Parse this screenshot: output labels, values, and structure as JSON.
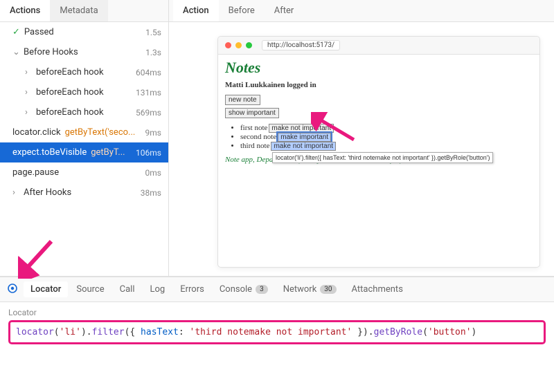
{
  "sidebar": {
    "tabs": {
      "actions": "Actions",
      "metadata": "Metadata"
    },
    "rows": {
      "passed": {
        "label": "Passed",
        "dur": "1.5s"
      },
      "before_hooks": {
        "label": "Before Hooks",
        "dur": "1.3s"
      },
      "be1": {
        "label": "beforeEach hook",
        "dur": "604ms"
      },
      "be2": {
        "label": "beforeEach hook",
        "dur": "131ms"
      },
      "be3": {
        "label": "beforeEach hook",
        "dur": "569ms"
      },
      "locator_click": {
        "prefix": "locator.click",
        "arg": "getByText('seco...",
        "dur": "9ms"
      },
      "expect": {
        "prefix": "expect.toBeVisible",
        "arg": "getByT...",
        "dur": "106ms"
      },
      "pause": {
        "label": "page.pause",
        "dur": "0ms"
      },
      "after_hooks": {
        "label": "After Hooks",
        "dur": "38ms"
      }
    }
  },
  "main_tabs": {
    "action": "Action",
    "before": "Before",
    "after": "After"
  },
  "browser": {
    "url": "http://localhost:5173/",
    "title": "Notes",
    "login_status": "Matti Luukkainen logged in",
    "new_note_btn": "new note",
    "show_important_btn": "show important",
    "notes": [
      {
        "text": "first note",
        "btn": "make not important"
      },
      {
        "text": "second note",
        "btn": "make important"
      },
      {
        "text": "third note",
        "btn": "make not important"
      }
    ],
    "tooltip": "locator('li').filter({ hasText: 'third notemake not important' }).getByRole('button')",
    "footer": "Note app, Department of Computer Science, University of Helsinki 2024"
  },
  "bottom_tabs": {
    "locator": "Locator",
    "source": "Source",
    "call": "Call",
    "log": "Log",
    "errors": "Errors",
    "console": "Console",
    "console_badge": "3",
    "network": "Network",
    "network_badge": "30",
    "attachments": "Attachments"
  },
  "locator": {
    "label": "Locator",
    "parts": {
      "fn1": "locator",
      "arg1": "'li'",
      "fn2": "filter",
      "key": "hasText",
      "arg2": "'third notemake not important'",
      "fn3": "getByRole",
      "arg3": "'button'"
    }
  }
}
